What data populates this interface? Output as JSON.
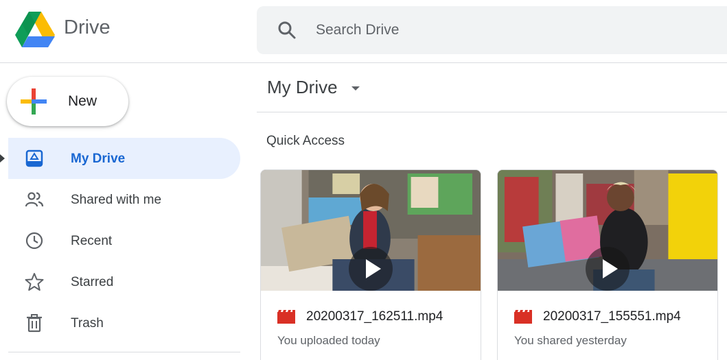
{
  "header": {
    "app_title": "Drive",
    "logo_icon": "google-drive-logo",
    "search": {
      "placeholder": "Search Drive",
      "icon": "search-icon"
    }
  },
  "sidebar": {
    "new_button": {
      "label": "New",
      "icon": "plus-multicolor-icon"
    },
    "items": [
      {
        "label": "My Drive",
        "icon": "my-drive-icon",
        "active": true
      },
      {
        "label": "Shared with me",
        "icon": "people-icon",
        "active": false
      },
      {
        "label": "Recent",
        "icon": "clock-icon",
        "active": false
      },
      {
        "label": "Starred",
        "icon": "star-icon",
        "active": false
      },
      {
        "label": "Trash",
        "icon": "trash-icon",
        "active": false
      }
    ]
  },
  "main": {
    "breadcrumb": "My Drive",
    "quick_access": {
      "heading": "Quick Access",
      "files": [
        {
          "name": "20200317_162511.mp4",
          "meta": "You uploaded today",
          "type_icon": "video-file-icon"
        },
        {
          "name": "20200317_155551.mp4",
          "meta": "You shared yesterday",
          "type_icon": "video-file-icon"
        }
      ]
    }
  },
  "colors": {
    "accent": "#1967d2",
    "active_bg": "#e8f0fe",
    "search_bg": "#f1f3f4",
    "video_icon": "#d93025"
  }
}
